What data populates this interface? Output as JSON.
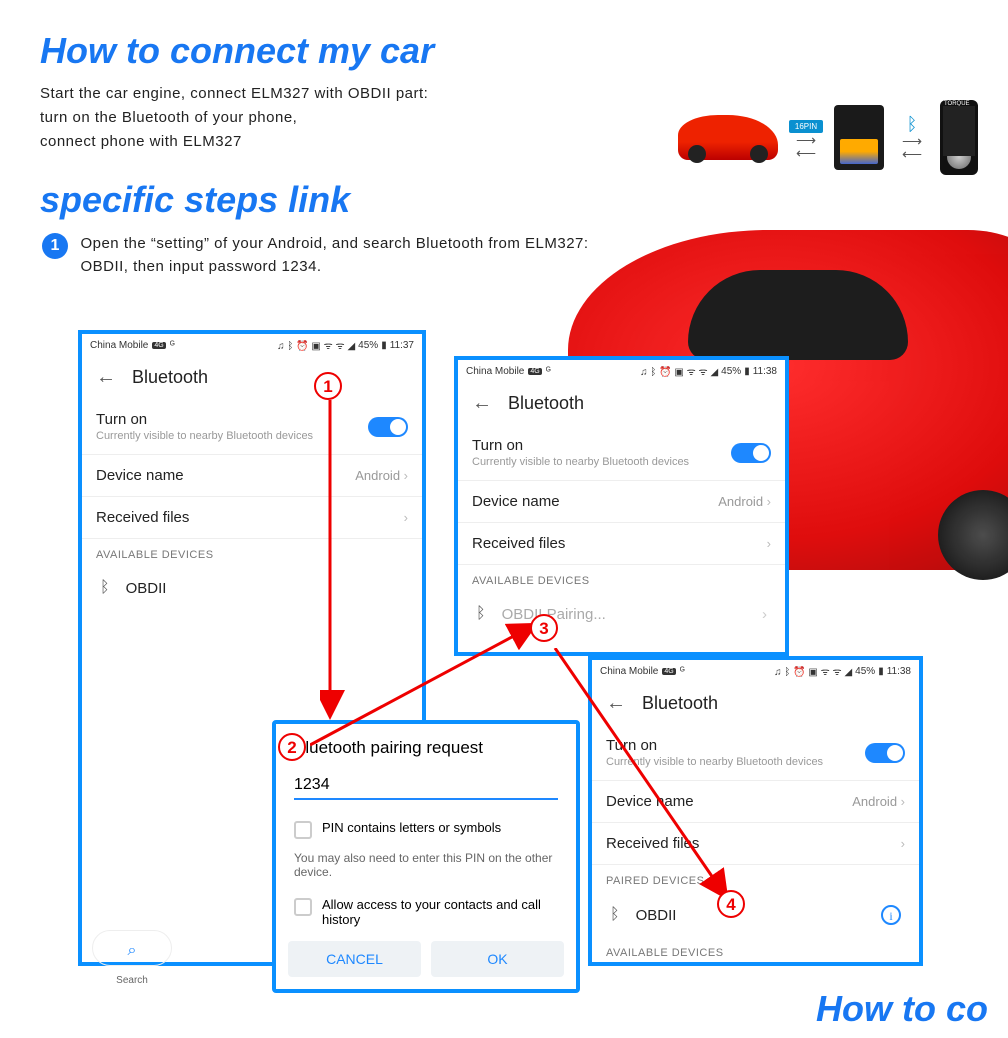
{
  "titles": {
    "main": "How to connect my car",
    "sub": "specific steps link",
    "bottom": "How to co"
  },
  "intro": {
    "l1": "Start the car engine, connect ELM327 with OBDII part:",
    "l2": "turn on the Bluetooth of your phone,",
    "l3": "connect phone with ELM327"
  },
  "flow": {
    "pin_badge": "16PIN",
    "torque": "TORQUE"
  },
  "step1": {
    "num": "1",
    "text": "Open the “setting” of your Android, and search Bluetooth from ELM327: OBDII, then input password 1234."
  },
  "status": {
    "carrier": "China Mobile",
    "fourg": "4G",
    "pct": "45%",
    "t1": "11:37",
    "t2": "11:38",
    "t3": "11:38"
  },
  "bt": {
    "title": "Bluetooth",
    "turn_on": "Turn on",
    "visible": "Currently visible to nearby Bluetooth devices",
    "device_name": "Device name",
    "device_val": "Android",
    "received": "Received files",
    "avail": "AVAILABLE DEVICES",
    "paired": "PAIRED DEVICES",
    "obdii": "OBDII",
    "pairing": "Pairing...",
    "search": "Search"
  },
  "dlg": {
    "title": "Bluetooth pairing request",
    "pin": "1234",
    "cb1": "PIN contains letters or symbols",
    "helper": "You may also need to enter this PIN on the other device.",
    "cb2": "Allow access to your contacts and call history",
    "cancel": "CANCEL",
    "ok": "OK"
  },
  "circ": {
    "a": "1",
    "b": "2",
    "c": "3",
    "d": "4"
  }
}
